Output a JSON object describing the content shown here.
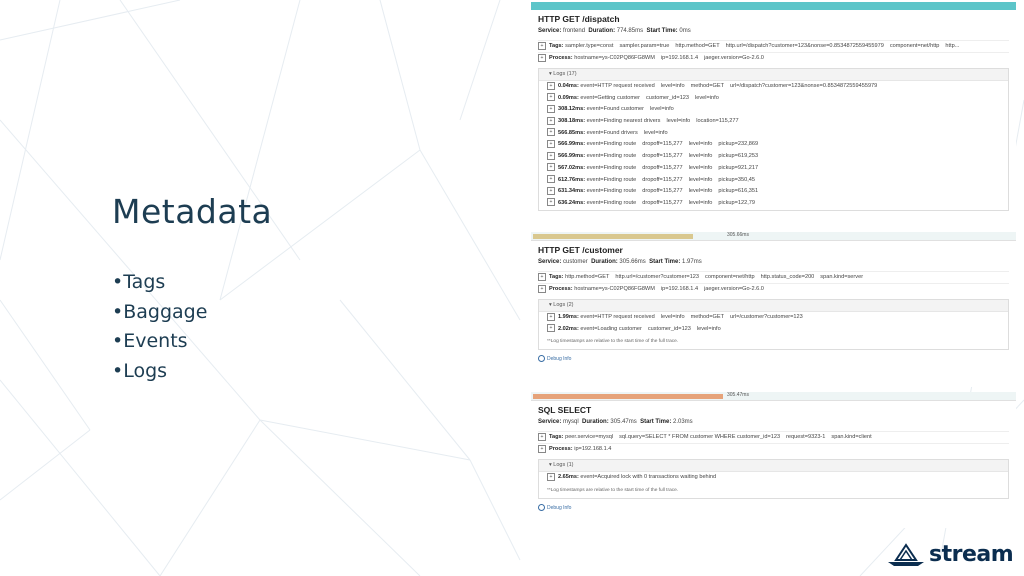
{
  "slide": {
    "title": "Metadata",
    "bullets": [
      "Tags",
      "Baggage",
      "Events",
      "Logs"
    ]
  },
  "colors": {
    "title": "#1d3d52",
    "teal": "#5cc5c9",
    "orange_bar": "#e6a37a",
    "logo": "#0b2d4f"
  },
  "spans": [
    {
      "title": "HTTP GET /dispatch",
      "service_label": "Service:",
      "service": "frontend",
      "duration_label": "Duration:",
      "duration": "774.85ms",
      "start_label": "Start Time:",
      "start": "0ms",
      "tags_label": "Tags:",
      "tags": [
        "sampler.type=const",
        "sampler.param=true",
        "http.method=GET",
        "http.url=/dispatch?customer=123&nonse=0.8534872559455979",
        "component=net/http",
        "http..."
      ],
      "process_label": "Process:",
      "process": [
        "hostname=ys-C02PQ86FG8WM",
        "ip=192.168.1.4",
        "jaeger.version=Go-2.6.0"
      ],
      "logs_label": "Logs (17)",
      "logs": [
        {
          "time": "0.04ms:",
          "fields": [
            "event=HTTP request received",
            "level=info",
            "method=GET",
            "url=/dispatch?customer=123&nonse=0.8534872559455979"
          ]
        },
        {
          "time": "0.09ms:",
          "fields": [
            "event=Getting customer",
            "customer_id=123",
            "level=info"
          ]
        },
        {
          "time": "308.12ms:",
          "fields": [
            "event=Found customer",
            "level=info"
          ]
        },
        {
          "time": "308.18ms:",
          "fields": [
            "event=Finding nearest drivers",
            "level=info",
            "location=115,277"
          ]
        },
        {
          "time": "566.85ms:",
          "fields": [
            "event=Found drivers",
            "level=info"
          ]
        },
        {
          "time": "566.99ms:",
          "fields": [
            "event=Finding route",
            "dropoff=115,277",
            "level=info",
            "pickup=232,869"
          ]
        },
        {
          "time": "566.99ms:",
          "fields": [
            "event=Finding route",
            "dropoff=115,277",
            "level=info",
            "pickup=619,253"
          ]
        },
        {
          "time": "567.02ms:",
          "fields": [
            "event=Finding route",
            "dropoff=115,277",
            "level=info",
            "pickup=921,217"
          ]
        },
        {
          "time": "612.76ms:",
          "fields": [
            "event=Finding route",
            "dropoff=115,277",
            "level=info",
            "pickup=350,45"
          ]
        },
        {
          "time": "631.34ms:",
          "fields": [
            "event=Finding route",
            "dropoff=115,277",
            "level=info",
            "pickup=616,351"
          ]
        },
        {
          "time": "636.24ms:",
          "fields": [
            "event=Finding route",
            "dropoff=115,277",
            "level=info",
            "pickup=122,79"
          ]
        }
      ]
    },
    {
      "timeline_label": "305.66ms",
      "title": "HTTP GET /customer",
      "service_label": "Service:",
      "service": "customer",
      "duration_label": "Duration:",
      "duration": "305.66ms",
      "start_label": "Start Time:",
      "start": "1.97ms",
      "tags_label": "Tags:",
      "tags": [
        "http.method=GET",
        "http.url=/customer?customer=123",
        "component=net/http",
        "http.status_code=200",
        "span.kind=server"
      ],
      "process_label": "Process:",
      "process": [
        "hostname=ys-C02PQ86FG8WM",
        "ip=192.168.1.4",
        "jaeger.version=Go-2.6.0"
      ],
      "logs_label": "Logs (2)",
      "logs": [
        {
          "time": "1.99ms:",
          "fields": [
            "event=HTTP request received",
            "level=info",
            "method=GET",
            "url=/customer?customer=123"
          ]
        },
        {
          "time": "2.02ms:",
          "fields": [
            "event=Loading customer",
            "customer_id=123",
            "level=info"
          ]
        }
      ],
      "note": "**Log timestamps are relative to the start time of the full trace.",
      "debug": "Debug Info"
    },
    {
      "timeline_label": "305.47ms",
      "title": "SQL SELECT",
      "service_label": "Service:",
      "service": "mysql",
      "duration_label": "Duration:",
      "duration": "305.47ms",
      "start_label": "Start Time:",
      "start": "2.03ms",
      "tags_label": "Tags:",
      "tags": [
        "peer.service=mysql",
        "sql.query=SELECT * FROM customer WHERE customer_id=123",
        "request=9323-1",
        "span.kind=client"
      ],
      "process_label": "Process:",
      "process": [
        "ip=192.168.1.4"
      ],
      "logs_label": "Logs (1)",
      "logs": [
        {
          "time": "2.65ms:",
          "fields": [
            "event=Acquired lock with 0 transactions waiting behind"
          ]
        }
      ],
      "note": "**Log timestamps are relative to the start time of the full trace.",
      "debug": "Debug Info"
    }
  ],
  "logo": {
    "text": "stream",
    "icon": "boat-icon"
  }
}
